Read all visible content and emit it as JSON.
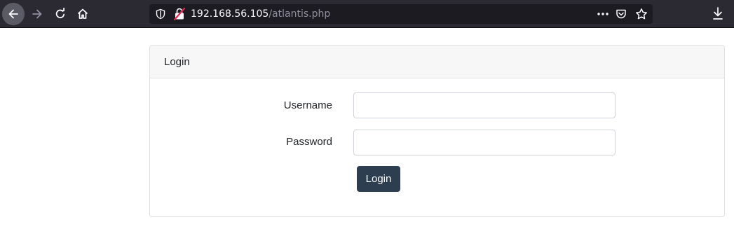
{
  "browser": {
    "url_host": "192.168.56.105",
    "url_path": "/atlantis.php",
    "icons": {
      "back": "back-arrow-icon",
      "forward": "forward-arrow-icon",
      "reload": "reload-icon",
      "home": "home-icon",
      "shield": "tracking-shield-icon",
      "lock": "insecure-lock-icon",
      "more": "more-dots-icon",
      "pocket": "pocket-icon",
      "star": "bookmark-star-icon",
      "download": "download-icon"
    },
    "colors": {
      "toolbar": "#2b2a33",
      "urlbar": "#1c1b22",
      "insecure": "#e22850"
    }
  },
  "card": {
    "header": "Login",
    "username_label": "Username",
    "username_value": "",
    "password_label": "Password",
    "password_value": "",
    "submit_label": "Login",
    "colors": {
      "button": "#2c3e50",
      "header_bg": "#f7f7f7"
    }
  }
}
